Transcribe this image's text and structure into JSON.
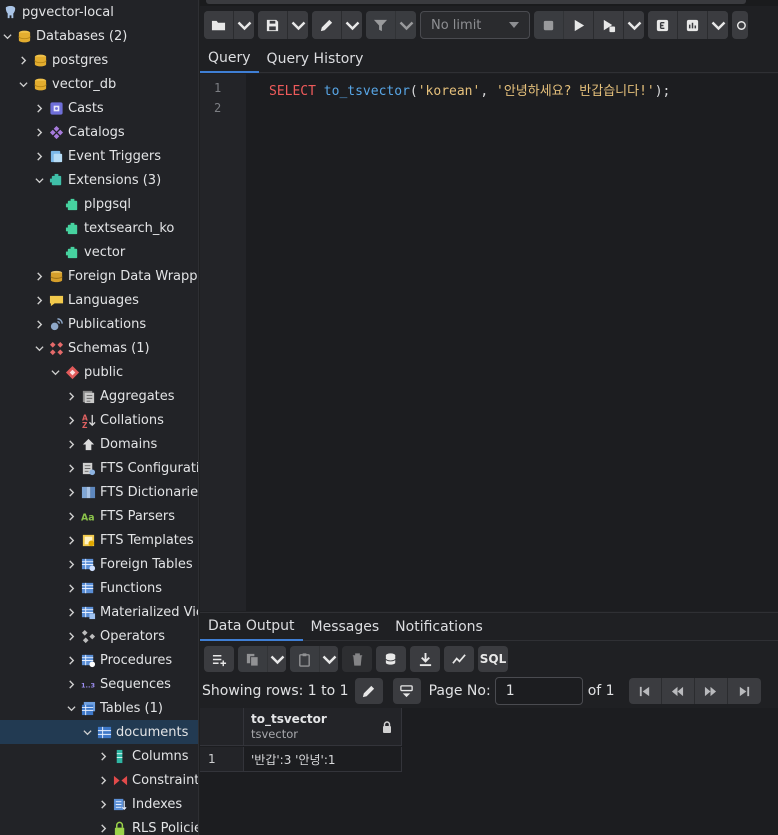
{
  "sidebar": {
    "items": [
      {
        "label": "pgvector-local",
        "depth": 0,
        "expand": "none",
        "icon": "elephant-icon"
      },
      {
        "label": "Databases (2)",
        "depth": 0,
        "expand": "open",
        "icon": "databases-icon"
      },
      {
        "label": "postgres",
        "depth": 1,
        "expand": "closed",
        "icon": "database-icon"
      },
      {
        "label": "vector_db",
        "depth": 1,
        "expand": "open",
        "icon": "database-icon"
      },
      {
        "label": "Casts",
        "depth": 2,
        "expand": "closed",
        "icon": "casts-icon"
      },
      {
        "label": "Catalogs",
        "depth": 2,
        "expand": "closed",
        "icon": "catalogs-icon"
      },
      {
        "label": "Event Triggers",
        "depth": 2,
        "expand": "closed",
        "icon": "event-triggers-icon"
      },
      {
        "label": "Extensions (3)",
        "depth": 2,
        "expand": "open",
        "icon": "extensions-icon"
      },
      {
        "label": "plpgsql",
        "depth": 3,
        "expand": "none",
        "icon": "extension-icon"
      },
      {
        "label": "textsearch_ko",
        "depth": 3,
        "expand": "none",
        "icon": "extension-icon"
      },
      {
        "label": "vector",
        "depth": 3,
        "expand": "none",
        "icon": "extension-icon"
      },
      {
        "label": "Foreign Data Wrappers",
        "depth": 2,
        "expand": "closed",
        "icon": "fdw-icon"
      },
      {
        "label": "Languages",
        "depth": 2,
        "expand": "closed",
        "icon": "languages-icon"
      },
      {
        "label": "Publications",
        "depth": 2,
        "expand": "closed",
        "icon": "publications-icon"
      },
      {
        "label": "Schemas (1)",
        "depth": 2,
        "expand": "open",
        "icon": "schemas-icon"
      },
      {
        "label": "public",
        "depth": 3,
        "expand": "open",
        "icon": "schema-icon"
      },
      {
        "label": "Aggregates",
        "depth": 4,
        "expand": "closed",
        "icon": "aggregates-icon"
      },
      {
        "label": "Collations",
        "depth": 4,
        "expand": "closed",
        "icon": "collations-icon"
      },
      {
        "label": "Domains",
        "depth": 4,
        "expand": "closed",
        "icon": "domains-icon"
      },
      {
        "label": "FTS Configurations",
        "depth": 4,
        "expand": "closed",
        "icon": "fts-configurations-icon"
      },
      {
        "label": "FTS Dictionaries",
        "depth": 4,
        "expand": "closed",
        "icon": "fts-dictionaries-icon"
      },
      {
        "label": "FTS Parsers",
        "depth": 4,
        "expand": "closed",
        "icon": "fts-parsers-icon"
      },
      {
        "label": "FTS Templates",
        "depth": 4,
        "expand": "closed",
        "icon": "fts-templates-icon"
      },
      {
        "label": "Foreign Tables",
        "depth": 4,
        "expand": "closed",
        "icon": "foreign-tables-icon"
      },
      {
        "label": "Functions",
        "depth": 4,
        "expand": "closed",
        "icon": "functions-icon"
      },
      {
        "label": "Materialized Views",
        "depth": 4,
        "expand": "closed",
        "icon": "materialized-views-icon"
      },
      {
        "label": "Operators",
        "depth": 4,
        "expand": "closed",
        "icon": "operators-icon"
      },
      {
        "label": "Procedures",
        "depth": 4,
        "expand": "closed",
        "icon": "procedures-icon"
      },
      {
        "label": "Sequences",
        "depth": 4,
        "expand": "closed",
        "icon": "sequences-icon"
      },
      {
        "label": "Tables (1)",
        "depth": 4,
        "expand": "open",
        "icon": "tables-icon"
      },
      {
        "label": "documents",
        "depth": 5,
        "expand": "open",
        "icon": "table-icon",
        "selected": true
      },
      {
        "label": "Columns",
        "depth": 6,
        "expand": "closed",
        "icon": "columns-icon"
      },
      {
        "label": "Constraints",
        "depth": 6,
        "expand": "closed",
        "icon": "constraints-icon"
      },
      {
        "label": "Indexes",
        "depth": 6,
        "expand": "closed",
        "icon": "indexes-icon"
      },
      {
        "label": "RLS Policies",
        "depth": 6,
        "expand": "closed",
        "icon": "rls-policies-icon"
      }
    ]
  },
  "toolbar": {
    "limit_placeholder": "No limit"
  },
  "editor": {
    "tabs": [
      "Query",
      "Query History"
    ],
    "line_numbers": [
      "1",
      "2"
    ],
    "code": {
      "keyword": "SELECT",
      "function": "to_tsvector",
      "open_paren": "(",
      "arg1": "'korean'",
      "comma": ", ",
      "arg2": "'안녕하세요? 반갑습니다!'",
      "close": ");"
    }
  },
  "results": {
    "tabs": [
      "Data Output",
      "Messages",
      "Notifications"
    ],
    "showing_rows": "Showing rows: 1 to 1",
    "page_label": "Page No:",
    "page_value": "1",
    "page_of": "of 1",
    "sql_label": "SQL",
    "grid": {
      "columns": [
        {
          "name": "to_tsvector",
          "type": "tsvector"
        }
      ],
      "rows": [
        {
          "num": "1",
          "values": [
            "'반갑':3 '안녕':1"
          ]
        }
      ]
    }
  },
  "colors": {
    "accent": "#3f7fd5",
    "keyword": "#ef5b5b",
    "function": "#58a6e6",
    "string": "#e5c07b"
  }
}
